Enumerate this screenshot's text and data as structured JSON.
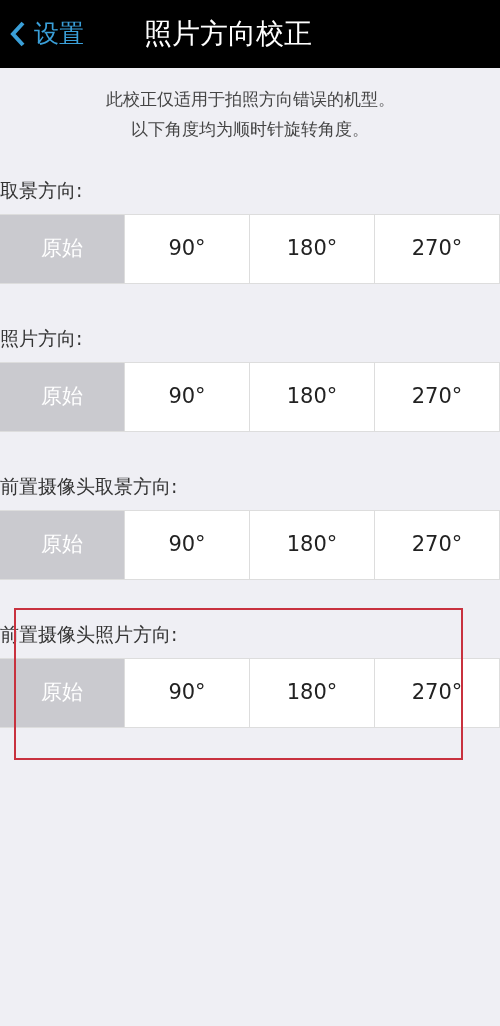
{
  "nav": {
    "back": "设置",
    "title": "照片方向校正"
  },
  "notes": [
    "此校正仅适用于拍照方向错误的机型。",
    "以下角度均为顺时针旋转角度。"
  ],
  "groups": [
    {
      "label": "取景方向:",
      "highlighted": false,
      "options": [
        {
          "label": "原始",
          "selected": true
        },
        {
          "label": "90°",
          "selected": false
        },
        {
          "label": "180°",
          "selected": false
        },
        {
          "label": "270°",
          "selected": false
        }
      ]
    },
    {
      "label": "照片方向:",
      "highlighted": false,
      "options": [
        {
          "label": "原始",
          "selected": true
        },
        {
          "label": "90°",
          "selected": false
        },
        {
          "label": "180°",
          "selected": false
        },
        {
          "label": "270°",
          "selected": false
        }
      ]
    },
    {
      "label": "前置摄像头取景方向:",
      "highlighted": false,
      "options": [
        {
          "label": "原始",
          "selected": true
        },
        {
          "label": "90°",
          "selected": false
        },
        {
          "label": "180°",
          "selected": false
        },
        {
          "label": "270°",
          "selected": false
        }
      ]
    },
    {
      "label": "前置摄像头照片方向:",
      "highlighted": true,
      "options": [
        {
          "label": "原始",
          "selected": true
        },
        {
          "label": "90°",
          "selected": false
        },
        {
          "label": "180°",
          "selected": false
        },
        {
          "label": "270°",
          "selected": false
        }
      ]
    }
  ]
}
